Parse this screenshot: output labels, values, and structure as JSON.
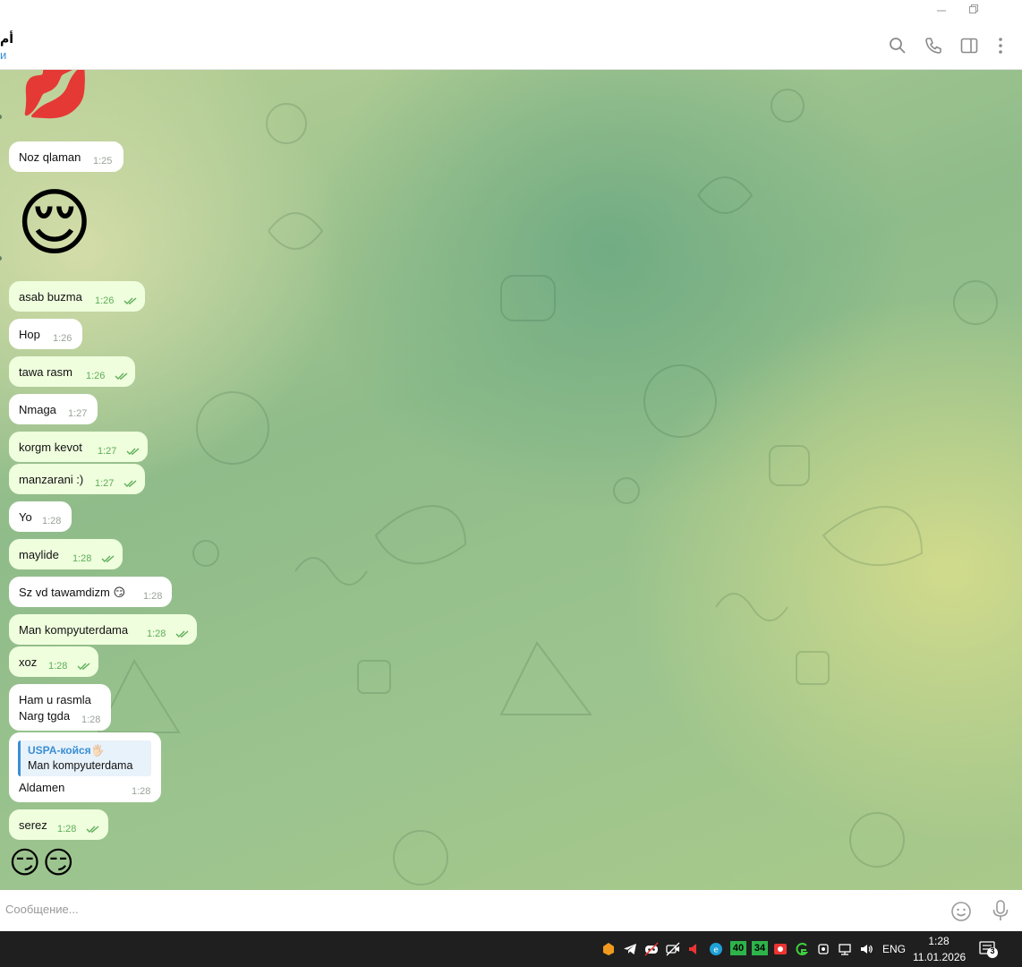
{
  "window": {
    "minimize_icon": "minimize-icon",
    "restore_icon": "restore-icon"
  },
  "header": {
    "chat_name": "أم",
    "status": "и"
  },
  "messages": [
    {
      "id": "m1",
      "text": "Noz qlaman",
      "time": "1:25",
      "out": false
    },
    {
      "id": "m2",
      "text": "asab buzma",
      "time": "1:26",
      "out": true
    },
    {
      "id": "m3",
      "text": "Hop",
      "time": "1:26",
      "out": false
    },
    {
      "id": "m4",
      "text": "tawa rasm",
      "time": "1:26",
      "out": true
    },
    {
      "id": "m5",
      "text": "Nmaga",
      "time": "1:27",
      "out": false
    },
    {
      "id": "m6",
      "text": "korgm kevot",
      "time": "1:27",
      "out": true
    },
    {
      "id": "m7",
      "text": "manzarani :)",
      "time": "1:27",
      "out": true
    },
    {
      "id": "m8",
      "text": "Yo",
      "time": "1:28",
      "out": false
    },
    {
      "id": "m9",
      "text": "maylide",
      "time": "1:28",
      "out": true
    },
    {
      "id": "m10",
      "text": "Sz vd tawamdizm 😏",
      "time": "1:28",
      "out": false
    },
    {
      "id": "m11",
      "text": "Man kompyuterdama",
      "time": "1:28",
      "out": true
    },
    {
      "id": "m12",
      "text": "xoz",
      "time": "1:28",
      "out": true
    },
    {
      "id": "m13",
      "line1": "Ham u rasmla",
      "line2": "Narg tgda",
      "time": "1:28",
      "out": false
    },
    {
      "id": "m14",
      "reply_name": "USPA-койся🖐🏻",
      "reply_text": "Man kompyuterdama",
      "text": "Aldamen",
      "time": "1:28",
      "out": false
    },
    {
      "id": "m15",
      "text": "serez",
      "time": "1:28",
      "out": true
    }
  ],
  "stickers": {
    "lips": "💋",
    "relieved": "😌",
    "smirk_pair": "😏😏"
  },
  "composer": {
    "placeholder": "Сообщение..."
  },
  "taskbar": {
    "badge_40": "40",
    "badge_34": "34",
    "language": "ENG",
    "time": "1:28",
    "date": "11.01.2026",
    "notifications": "3"
  },
  "colors": {
    "accent": "#3a8ed3",
    "outgoing_bubble": "#effedd",
    "read_check": "#5fae5a"
  }
}
